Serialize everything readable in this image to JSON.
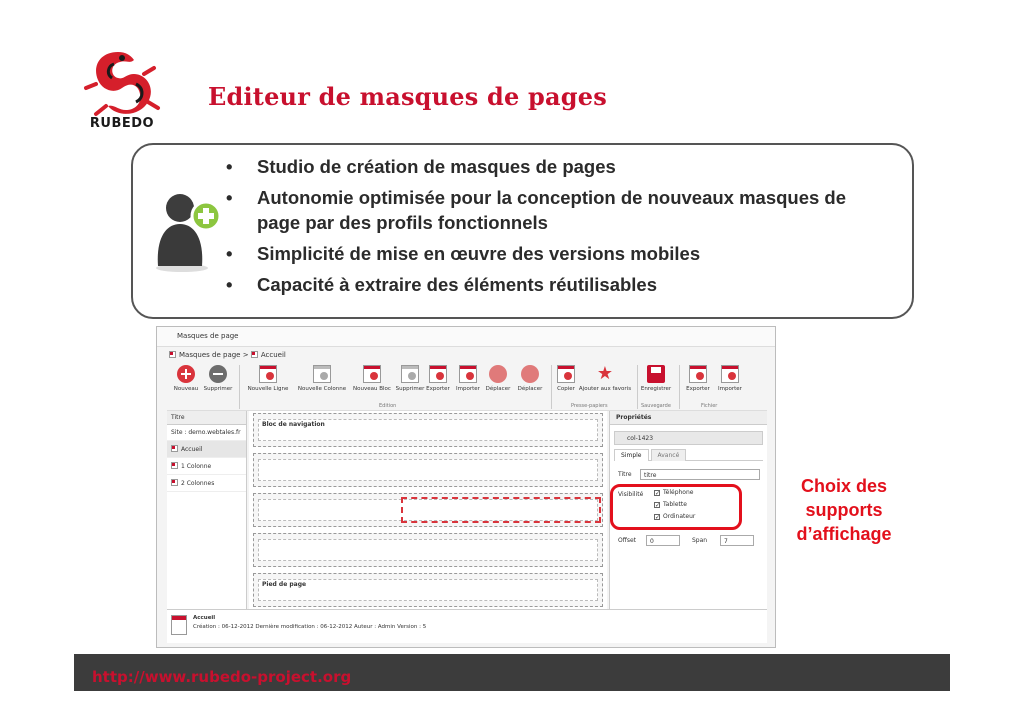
{
  "brand": {
    "logo_text": "RUBEDO",
    "accent": "#c8102e"
  },
  "slide": {
    "title": "Editeur de masques de pages"
  },
  "bullets": [
    "Studio de création de masques de pages",
    "Autonomie optimisée pour la conception de nouveaux masques de page par des profils fonctionnels",
    "Simplicité de mise en œuvre des versions mobiles",
    "Capacité à extraire des éléments réutilisables"
  ],
  "bullet_glyph": "•",
  "app": {
    "window_title": "Masques de page",
    "breadcrumb": [
      "Masques de page",
      ">",
      "Accueil"
    ],
    "toolbar": {
      "buttons": [
        "Nouveau",
        "Supprimer",
        "Nouvelle Ligne",
        "Nouvelle Colonne",
        "Nouveau Bloc",
        "Supprimer",
        "Exporter",
        "Importer",
        "Déplacer",
        "Déplacer",
        "Copier",
        "Ajouter aux favoris",
        "Enregistrer",
        "Exporter",
        "Importer"
      ],
      "groups": [
        "Edition",
        "Presse-papiers",
        "Sauvegarde",
        "Fichier"
      ]
    },
    "left_panel": {
      "header": "Titre",
      "site": "Site : demo.webtales.fr",
      "items": [
        "Accueil",
        "1 Colonne",
        "2 Colonnes"
      ]
    },
    "canvas": {
      "nav_block": "Bloc de navigation",
      "footer_block": "Pied de page"
    },
    "properties": {
      "title": "Propriétés",
      "element": "col-1423",
      "tabs": [
        "Simple",
        "Avancé"
      ],
      "titre_label": "Titre",
      "titre_value": "titre",
      "visibilite_label": "Visibilité",
      "devices": [
        "Téléphone",
        "Tablette",
        "Ordinateur"
      ],
      "check": "✓",
      "offset_label": "Offset",
      "offset_value": "0",
      "span_label": "Span",
      "span_value": "7"
    },
    "status": {
      "page": "Accueil",
      "meta": "Création : 06-12-2012 Dernière modification : 06-12-2012 Auteur : Admin Version : 5"
    }
  },
  "callout": "Choix des supports d’affichage",
  "footer": {
    "url": "http://www.rubedo-project.org"
  }
}
